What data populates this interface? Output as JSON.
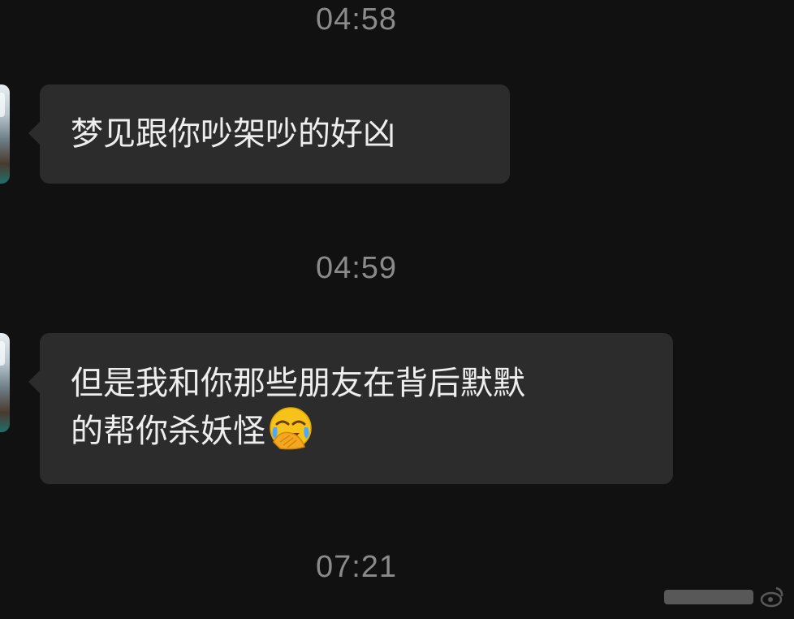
{
  "messages": [
    {
      "time": "04:58",
      "lines": [
        "梦见跟你吵架吵的好凶"
      ]
    },
    {
      "time": "04:59",
      "lines": [
        "但是我和你那些朋友在背后默默",
        "的帮你杀妖怪"
      ],
      "emoji": "face-palm-tears-emoji"
    },
    {
      "time": "07:21"
    }
  ],
  "colors": {
    "background": "#111111",
    "bubble": "#2c2c2c",
    "text": "#eeeeee",
    "timestamp": "#8b8b8b"
  }
}
